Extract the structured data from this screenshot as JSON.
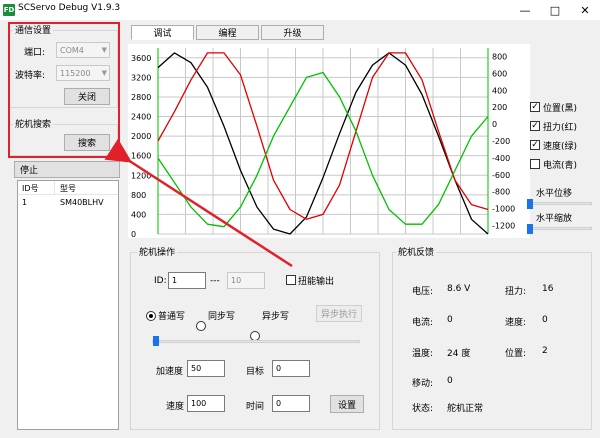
{
  "window": {
    "title": "SCServo Debug V1.9.3",
    "icon_text": "FD"
  },
  "connection": {
    "title": "通信设置",
    "port_label": "端口:",
    "port_value": "COM4",
    "baud_label": "波特率:",
    "baud_value": "115200",
    "close_button": "关闭"
  },
  "servo_search": {
    "title": "舵机搜索",
    "search_button": "搜索"
  },
  "stop_button": "停止",
  "servo_list": {
    "columns": [
      "ID号",
      "型号"
    ],
    "rows": [
      {
        "id": "1",
        "model": "SM40BLHV"
      }
    ]
  },
  "tabs": [
    {
      "label": "调试"
    },
    {
      "label": "编程"
    },
    {
      "label": "升级"
    }
  ],
  "chart_data": {
    "type": "line",
    "left_axis": {
      "ticks": [
        "3600",
        "3200",
        "2800",
        "2400",
        "2000",
        "1600",
        "1200",
        "800",
        "400",
        "0"
      ],
      "ylim": [
        0,
        3800
      ]
    },
    "right_axis": {
      "ticks": [
        "800",
        "600",
        "400",
        "200",
        "0",
        "-200",
        "-400",
        "-600",
        "-800",
        "-1000",
        "-1200"
      ],
      "ylim": [
        -1300,
        900
      ]
    },
    "grid": true,
    "legend": "right",
    "x": [
      0,
      0.5,
      1.0,
      1.5,
      2.0,
      2.5,
      3.0,
      3.5,
      4.0,
      4.5,
      5.0,
      5.5,
      6.0,
      6.5,
      7.0,
      7.5,
      8.0,
      8.5,
      9.0,
      9.5,
      10.0
    ],
    "series": [
      {
        "name": "位置(黑)",
        "color": "#000000",
        "axis": "left",
        "values": [
          3400,
          3700,
          3500,
          3000,
          2200,
          1300,
          550,
          100,
          0,
          350,
          1150,
          2050,
          2900,
          3450,
          3700,
          3450,
          2850,
          2000,
          1100,
          300,
          0
        ]
      },
      {
        "name": "扭力(红)",
        "color": "#e00000",
        "axis": "left",
        "values": [
          1900,
          2500,
          3150,
          3700,
          3700,
          3250,
          2200,
          1100,
          500,
          300,
          400,
          1000,
          2100,
          3200,
          3700,
          3700,
          3150,
          2100,
          1100,
          600,
          500
        ]
      },
      {
        "name": "速度(绿)",
        "color": "#00c000",
        "axis": "left",
        "values": [
          1550,
          1050,
          550,
          200,
          150,
          550,
          1200,
          2000,
          2600,
          3200,
          3300,
          2800,
          2100,
          1200,
          500,
          200,
          200,
          600,
          1300,
          2000,
          2400
        ]
      }
    ]
  },
  "legend_items": [
    {
      "label": "位置(黑)",
      "checked": true
    },
    {
      "label": "扭力(红)",
      "checked": true
    },
    {
      "label": "速度(绿)",
      "checked": true
    },
    {
      "label": "电流(青)",
      "checked": false
    }
  ],
  "zoom": {
    "h_pos_label": "水平位移",
    "h_zoom_label": "水平缩放"
  },
  "servo_ops": {
    "title": "舵机操作",
    "id_label": "ID:",
    "id_value": "1",
    "id_sep": "---",
    "id_end": "10",
    "torque_output": "扭能输出",
    "modes": [
      {
        "label": "普通写",
        "selected": true
      },
      {
        "label": "同步写",
        "selected": false
      },
      {
        "label": "异步写",
        "selected": false
      }
    ],
    "async_exec": "异步执行",
    "accel_label": "加速度",
    "accel_value": "50",
    "target_label": "目标",
    "target_value": "0",
    "speed_label": "速度",
    "speed_value": "100",
    "time_label": "时间",
    "time_value": "0",
    "set_button": "设置"
  },
  "feedback": {
    "title": "舵机反馈",
    "voltage_label": "电压:",
    "voltage_value": "8.6 V",
    "torque_label": "扭力:",
    "torque_value": "16",
    "current_label": "电流:",
    "current_value": "0",
    "speed_label": "速度:",
    "speed_value": "0",
    "temp_label": "温度:",
    "temp_value": "24 度",
    "position_label": "位置:",
    "position_value": "2",
    "moving_label": "移动:",
    "moving_value": "0",
    "status_label": "状态:",
    "status_value": "舵机正常"
  },
  "colors": {
    "annotation": "#e0202a",
    "slider_thumb": "#1a73e8"
  }
}
